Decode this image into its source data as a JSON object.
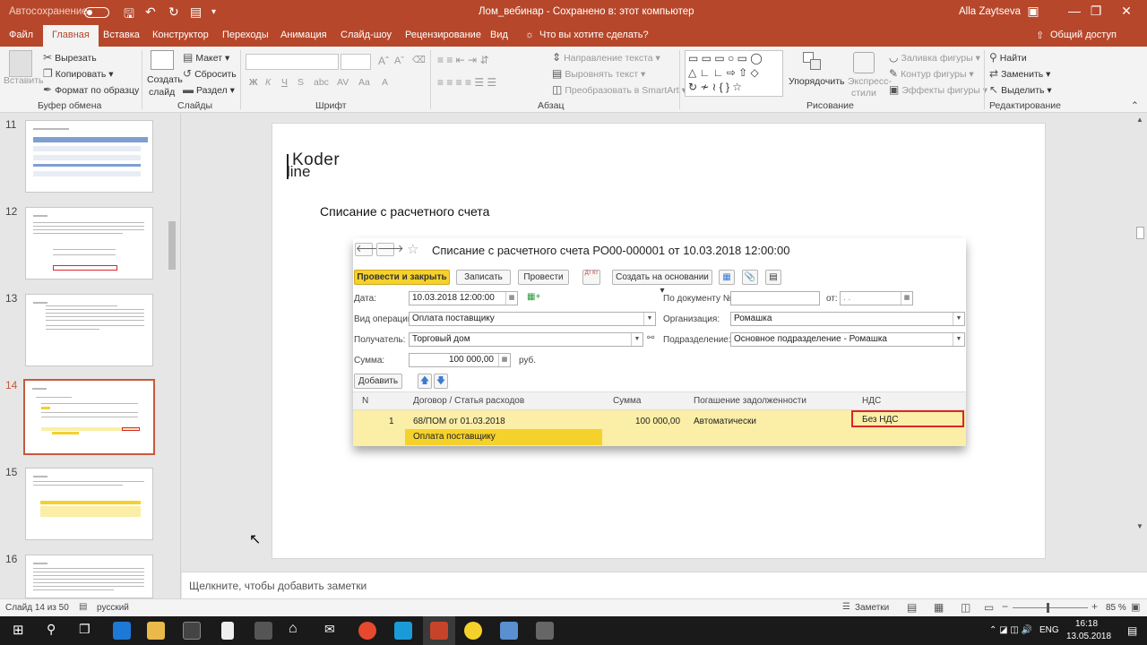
{
  "titlebar": {
    "autosave": "Автосохранение",
    "autosave_state": "Откл.",
    "doc_title": "Лом_вебинар  -  Сохранено в: этот компьютер",
    "user": "Alla Zaytseva"
  },
  "tabs": [
    "Файл",
    "Главная",
    "Вставка",
    "Конструктор",
    "Переходы",
    "Анимация",
    "Слайд-шоу",
    "Рецензирование",
    "Вид"
  ],
  "tellme": "Что вы хотите сделать?",
  "share": "Общий доступ",
  "ribbon": {
    "paste": "Вставить",
    "cut": "Вырезать",
    "copy": "Копировать",
    "format_painter": "Формат по образцу",
    "clipboard": "Буфер обмена",
    "new_slide_1": "Создать",
    "new_slide_2": "слайд",
    "layout": "Макет",
    "reset": "Сбросить",
    "section": "Раздел",
    "slides": "Слайды",
    "font_group": "Шрифт",
    "paragraph": "Абзац",
    "text_direction": "Направление текста",
    "align_text": "Выровнять текст",
    "smartart": "Преобразовать в SmartArt",
    "arrange": "Упорядочить",
    "quick_styles_1": "Экспресс-",
    "quick_styles_2": "стили",
    "shape_fill": "Заливка фигуры",
    "shape_outline": "Контур фигуры",
    "shape_effects": "Эффекты фигуры",
    "drawing": "Рисование",
    "find": "Найти",
    "replace": "Заменить",
    "select": "Выделить",
    "editing": "Редактирование"
  },
  "thumbnails": [
    {
      "num": "11"
    },
    {
      "num": "12"
    },
    {
      "num": "13"
    },
    {
      "num": "14",
      "selected": true
    },
    {
      "num": "15"
    },
    {
      "num": "16"
    }
  ],
  "slide": {
    "logo_1": "Koder",
    "logo_2": "line",
    "heading": "Списание с расчетного счета",
    "doc": {
      "title": "Списание с расчетного счета РО00-000001 от 10.03.2018 12:00:00",
      "buttons": {
        "post_close": "Провести и закрыть",
        "save": "Записать",
        "post": "Провести",
        "dt_kt": "Дт Кт",
        "create_based": "Создать на основании"
      },
      "date_label": "Дата:",
      "date_value": "10.03.2018 12:00:00",
      "doc_no_label": "По документу №:",
      "from_label": "от:",
      "from_value": " .  .",
      "operation_label": "Вид операции:",
      "operation_value": "Оплата поставщику",
      "org_label": "Организация:",
      "org_value": "Ромашка",
      "recipient_label": "Получатель:",
      "recipient_value": "Торговый дом",
      "dept_label": "Подразделение:",
      "dept_value": "Основное подразделение - Ромашка",
      "sum_label": "Сумма:",
      "sum_value": "100 000,00",
      "currency": "руб.",
      "add_button": "Добавить",
      "table": {
        "headers": [
          "N",
          "Договор / Статья расходов",
          "Сумма",
          "Погашение задолженности",
          "НДС"
        ],
        "row": {
          "n": "1",
          "contract": "68/ПОМ от 01.03.2018",
          "article": "Оплата поставщику",
          "sum": "100 000,00",
          "repayment": "Автоматически",
          "vat": "Без НДС"
        }
      }
    }
  },
  "notes_placeholder": "Щелкните, чтобы добавить заметки",
  "status": {
    "slide_of": "Слайд 14 из 50",
    "language": "русский",
    "notes": "Заметки",
    "zoom": "85 %"
  },
  "taskbar": {
    "lang": "ENG",
    "time": "16:18",
    "date": "13.05.2018"
  },
  "colors": {
    "accent": "#b7472a",
    "onec_yellow": "#f5d12b",
    "row_yellow": "#fbeea6",
    "highlight_red": "#d9262c"
  }
}
